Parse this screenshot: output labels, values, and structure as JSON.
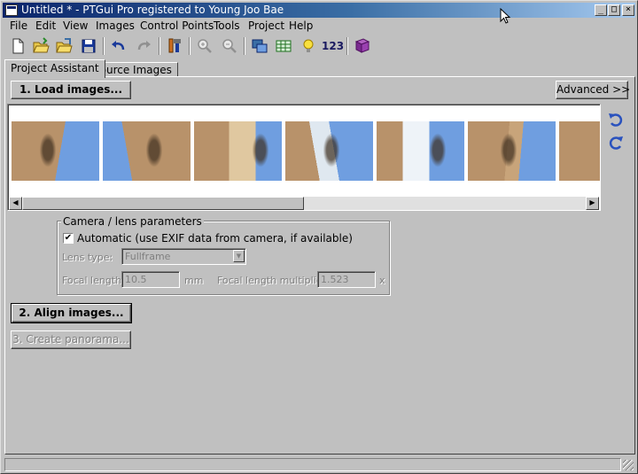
{
  "window": {
    "title": "Untitled * - PTGui Pro registered to Young Joo Bae",
    "controls": {
      "minimize": "_",
      "maximize": "□",
      "close": "×"
    }
  },
  "menu": [
    "File",
    "Edit",
    "View",
    "Images",
    "Control Points",
    "Tools",
    "Project",
    "Help"
  ],
  "toolbar": {
    "icons": [
      "new-file-icon",
      "open-folder-icon",
      "open-recent-icon",
      "save-icon",
      "undo-icon",
      "redo-icon",
      "tools-icon",
      "zoom-in-icon",
      "zoom-out-icon",
      "panorama-editor-icon",
      "table-icon",
      "light-bulb-icon",
      "numbers-icon",
      "help-book-icon"
    ],
    "numbers_label": "123"
  },
  "tabs": [
    {
      "label": "Project Assistant",
      "active": true
    },
    {
      "label": "Source Images",
      "active": false
    }
  ],
  "assistant": {
    "load_images": "1. Load images...",
    "advanced": "Advanced >>",
    "align_images": "2. Align images...",
    "create_panorama": "3. Create panorama..."
  },
  "camera": {
    "legend": "Camera / lens parameters",
    "automatic_checked": true,
    "automatic_label": "Automatic (use EXIF data from camera, if available)",
    "lens_type_label": "Lens type:",
    "lens_type_value": "Fullframe",
    "focal_length_label": "Focal length:",
    "focal_length_value": "10.5",
    "focal_length_unit": "mm",
    "multiplier_label": "Focal length multiplier:",
    "multiplier_value": "1.523",
    "multiplier_unit": "x"
  },
  "images": {
    "thumbnail_count": 7,
    "sky_color": "#6f9ee0",
    "ground_color": "#b8926a"
  },
  "colors": {
    "window_bg": "#c0c0c0",
    "titlebar_start": "#0a246a",
    "titlebar_end": "#a6caf0",
    "rotate_icon": "#2a52be"
  }
}
